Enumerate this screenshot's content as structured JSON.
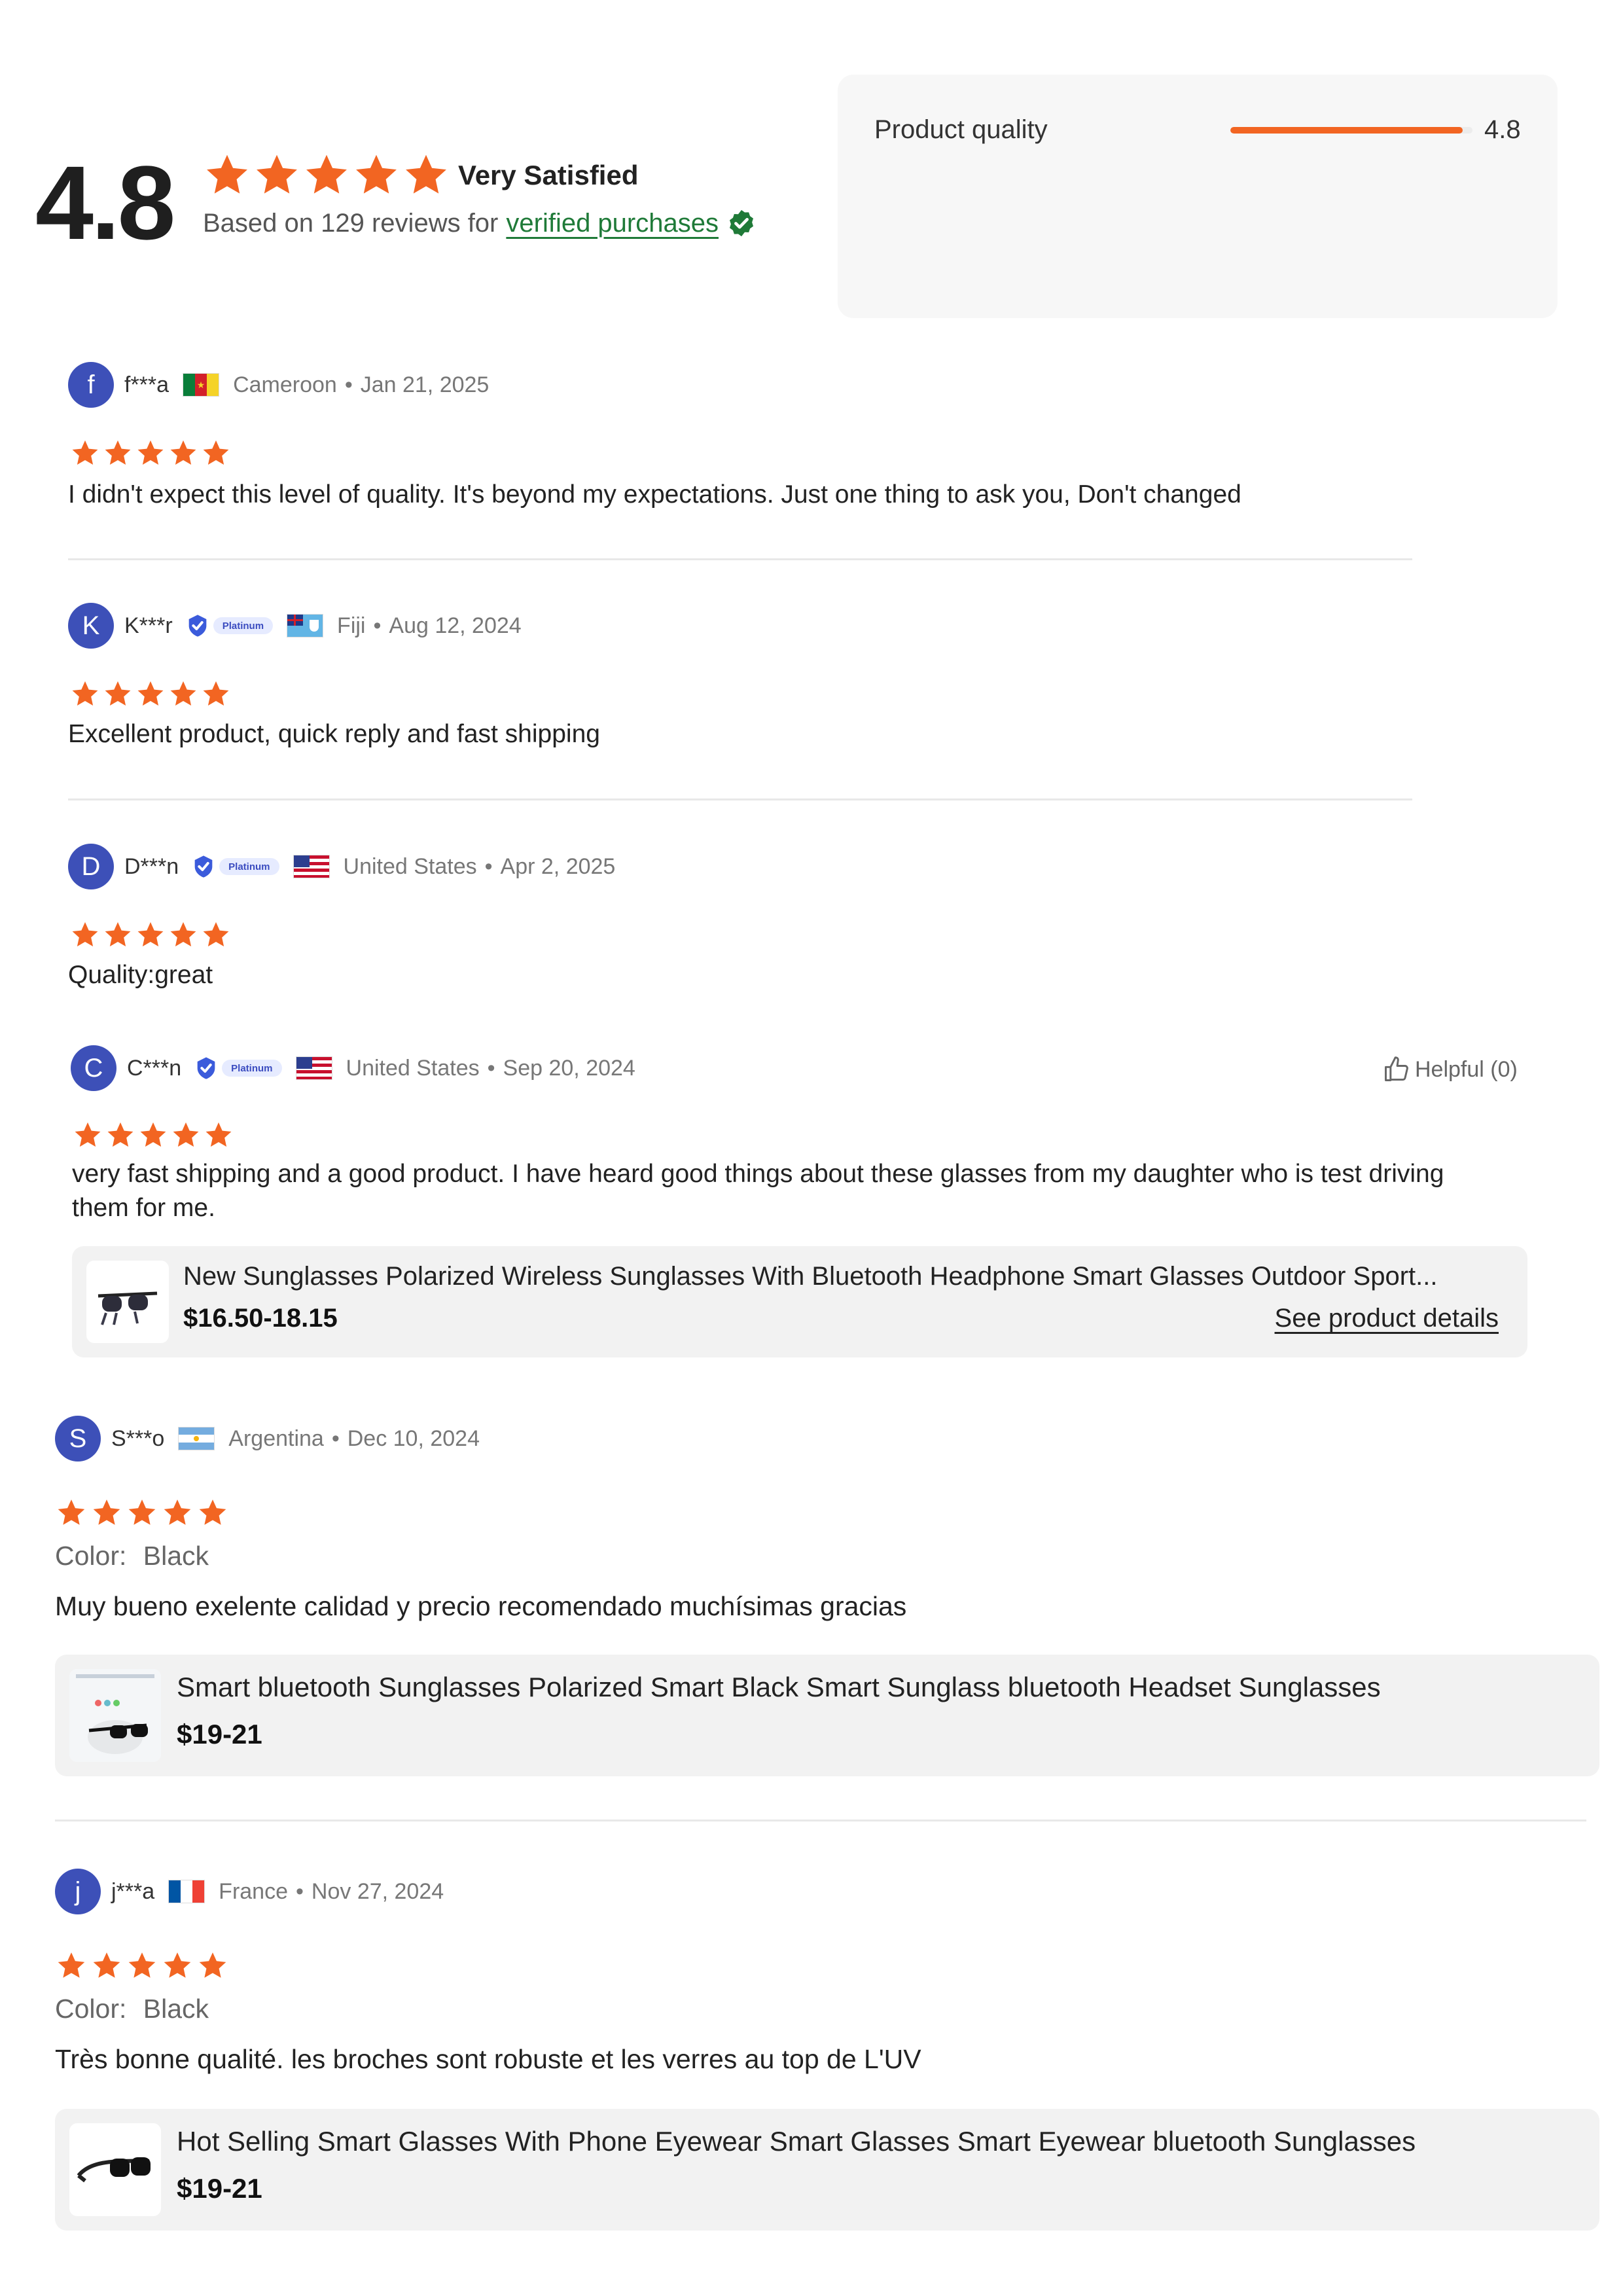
{
  "summary": {
    "score": "4.8",
    "stars": 5,
    "label": "Very Satisfied",
    "based_prefix": "Based on 129 reviews for",
    "verified_text": "verified purchases",
    "quality": {
      "label": "Product quality",
      "value": "4.8",
      "fraction": 0.96
    }
  },
  "colors": {
    "accent": "#f26522",
    "avatar": "#3d50b8",
    "verified": "#1f7a38",
    "badge": "#3b5bdb"
  },
  "reviews": [
    {
      "initial": "f",
      "user": "f***a",
      "country": "Cameroon",
      "flag": "cameroon-flag",
      "date": "Jan 21, 2025",
      "rating": 5,
      "text": "I didn't expect this level of quality. It's beyond my expectations. Just one thing to ask you, Don't changed"
    },
    {
      "initial": "K",
      "user": "K***r",
      "badge": "Platinum",
      "country": "Fiji",
      "flag": "fiji-flag",
      "date": "Aug 12, 2024",
      "rating": 5,
      "text": "Excellent product, quick reply and fast shipping"
    },
    {
      "initial": "D",
      "user": "D***n",
      "badge": "Platinum",
      "country": "United States",
      "flag": "us-flag",
      "date": "Apr 2, 2025",
      "rating": 5,
      "text": "Quality:great"
    },
    {
      "initial": "C",
      "user": "C***n",
      "badge": "Platinum",
      "country": "United States",
      "flag": "us-flag",
      "date": "Sep 20, 2024",
      "rating": 5,
      "helpful": "Helpful (0)",
      "text": "very fast shipping and a good product. I have heard good things about these glasses from my daughter who is test driving them for me.",
      "product": {
        "title": "New Sunglasses Polarized Wireless Sunglasses With Bluetooth Headphone Smart Glasses Outdoor Sport...",
        "price": "$16.50-18.15",
        "link": "See product details"
      }
    },
    {
      "initial": "S",
      "user": "S***o",
      "country": "Argentina",
      "flag": "argentina-flag",
      "date": "Dec 10, 2024",
      "rating": 5,
      "color_label": "Color:",
      "color_value": "Black",
      "text": "Muy bueno exelente calidad y precio recomendado muchísimas gracias",
      "product": {
        "title": "Smart bluetooth Sunglasses Polarized Smart Black Smart Sunglass bluetooth Headset Sunglasses",
        "price": "$19-21"
      }
    },
    {
      "initial": "j",
      "user": "j***a",
      "country": "France",
      "flag": "france-flag",
      "date": "Nov 27, 2024",
      "rating": 5,
      "color_label": "Color:",
      "color_value": "Black",
      "text": "Très bonne qualité. les broches sont robuste et les verres au top de L'UV",
      "product": {
        "title": "Hot Selling Smart Glasses With Phone Eyewear Smart Glasses Smart Eyewear bluetooth Sunglasses",
        "price": "$19-21"
      }
    }
  ]
}
